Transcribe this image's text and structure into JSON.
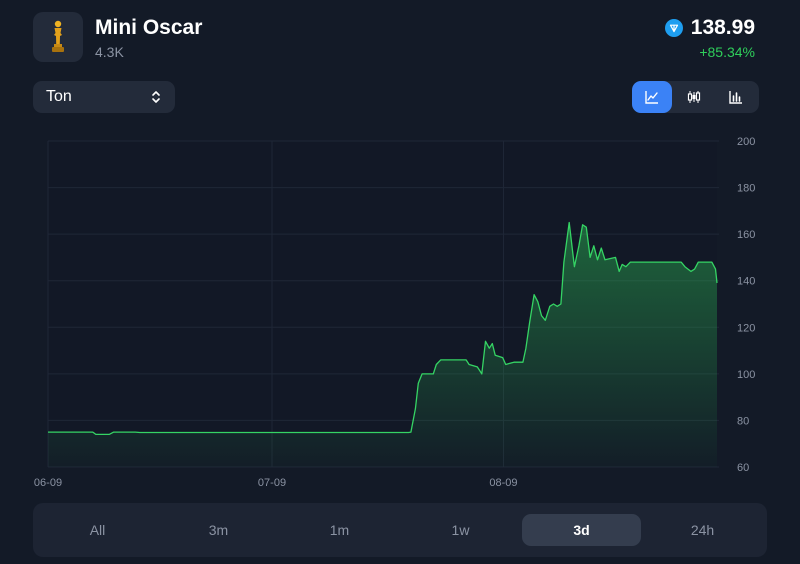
{
  "header": {
    "title": "Mini Oscar",
    "subtitle": "4.3K",
    "price": "138.99",
    "change": "+85.34%"
  },
  "currency": {
    "selected": "Ton"
  },
  "view_modes": [
    {
      "icon": "line-chart-icon",
      "active": true
    },
    {
      "icon": "candlestick-icon",
      "active": false
    },
    {
      "icon": "bar-chart-icon",
      "active": false
    }
  ],
  "time_ranges": [
    {
      "label": "All",
      "active": false
    },
    {
      "label": "3m",
      "active": false
    },
    {
      "label": "1m",
      "active": false
    },
    {
      "label": "1w",
      "active": false
    },
    {
      "label": "3d",
      "active": true
    },
    {
      "label": "24h",
      "active": false
    }
  ],
  "colors": {
    "background": "#131a27",
    "line": "#35d464",
    "positive": "#2fcf5b",
    "accent": "#3b82f6",
    "ton": "#1e9ef0"
  },
  "chart_data": {
    "type": "area",
    "x_ticks": [
      {
        "label": "06-09",
        "day": 0
      },
      {
        "label": "07-09",
        "day": 30
      },
      {
        "label": "08-09",
        "day": 61
      }
    ],
    "ylim": [
      60,
      200
    ],
    "y_ticks": [
      60,
      80,
      100,
      120,
      140,
      160,
      180,
      200
    ],
    "xlim": [
      0,
      89.6
    ],
    "grid": true,
    "series": [
      {
        "points": [
          [
            0,
            75
          ],
          [
            6,
            75
          ],
          [
            6.4,
            74
          ],
          [
            8.2,
            74
          ],
          [
            8.8,
            75
          ],
          [
            11.7,
            75
          ],
          [
            12.3,
            74.8
          ],
          [
            48.3,
            74.8
          ],
          [
            48.6,
            75
          ],
          [
            49.2,
            85
          ],
          [
            49.6,
            96
          ],
          [
            50.1,
            100
          ],
          [
            51.6,
            100
          ],
          [
            52.0,
            104
          ],
          [
            52.6,
            106
          ],
          [
            56.0,
            106
          ],
          [
            56.4,
            104
          ],
          [
            57.5,
            103
          ],
          [
            57.9,
            101
          ],
          [
            58.1,
            100
          ],
          [
            58.6,
            114
          ],
          [
            59.1,
            111
          ],
          [
            59.5,
            113
          ],
          [
            59.9,
            108
          ],
          [
            60.9,
            107
          ],
          [
            61.3,
            104
          ],
          [
            62.4,
            105
          ],
          [
            63.6,
            105
          ],
          [
            64.0,
            111
          ],
          [
            64.5,
            122
          ],
          [
            65.1,
            134
          ],
          [
            65.6,
            131
          ],
          [
            66.1,
            125
          ],
          [
            66.6,
            123
          ],
          [
            67.2,
            129
          ],
          [
            67.7,
            130
          ],
          [
            68.2,
            129
          ],
          [
            68.7,
            130
          ],
          [
            69.1,
            148
          ],
          [
            69.8,
            165
          ],
          [
            70.5,
            146
          ],
          [
            71.1,
            155
          ],
          [
            71.6,
            164
          ],
          [
            72.1,
            163
          ],
          [
            72.6,
            150
          ],
          [
            73.1,
            155
          ],
          [
            73.6,
            149
          ],
          [
            74.1,
            154
          ],
          [
            74.6,
            149
          ],
          [
            76.0,
            150
          ],
          [
            76.5,
            144
          ],
          [
            76.9,
            147
          ],
          [
            77.4,
            146
          ],
          [
            78.0,
            148
          ],
          [
            84.8,
            148
          ],
          [
            85.3,
            146
          ],
          [
            86.1,
            144
          ],
          [
            86.6,
            145
          ],
          [
            87.1,
            148
          ],
          [
            88.9,
            148
          ],
          [
            89.4,
            145
          ],
          [
            89.6,
            139
          ]
        ]
      }
    ]
  }
}
